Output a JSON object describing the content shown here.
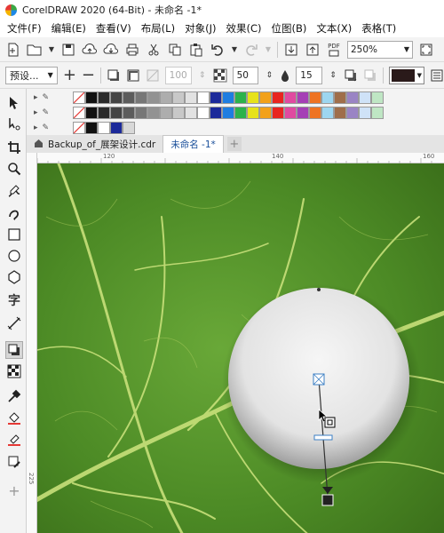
{
  "window": {
    "title": "CorelDRAW 2020 (64-Bit) - 未命名 -1*"
  },
  "menu": [
    "文件(F)",
    "编辑(E)",
    "查看(V)",
    "布局(L)",
    "对象(J)",
    "效果(C)",
    "位图(B)",
    "文本(X)",
    "表格(T)"
  ],
  "toolbar": {
    "zoom": "250%",
    "pdf_label": "PDF"
  },
  "property_bar": {
    "preset": "预设...",
    "transparency": "100",
    "feather": "50",
    "direction": "15"
  },
  "palette": {
    "row1": [
      "#ffffff",
      "#111111",
      "#2b2b2b",
      "#444444",
      "#5c5c5c",
      "#777777",
      "#929292",
      "#adadad",
      "#c8c8c8",
      "#e2e2e2",
      "#ffffff",
      "#1c2a9a",
      "#1f7de0",
      "#2cb24b",
      "#e7e21a",
      "#f2a11a",
      "#e8251f",
      "#e04aa0",
      "#a53fb5",
      "#ee7322",
      "#9dd6f0",
      "#9f6e4a",
      "#9a84c4",
      "#cfe2f7",
      "#bfe6c4"
    ],
    "row2": [
      "#ffffff",
      "#111111",
      "#2b2b2b",
      "#444444",
      "#5c5c5c",
      "#777777",
      "#929292",
      "#adadad",
      "#c8c8c8",
      "#e2e2e2",
      "#ffffff",
      "#1c2a9a",
      "#1f7de0",
      "#2cb24b",
      "#e7e21a",
      "#f2a11a",
      "#e8251f",
      "#e04aa0",
      "#a53fb5",
      "#ee7322",
      "#9dd6f0",
      "#9f6e4a",
      "#9a84c4",
      "#cfe2f7",
      "#bfe6c4"
    ],
    "row3": [
      "#ffffff",
      "#111111",
      "#ffffff",
      "#1c2a9a",
      "#d8d8d8"
    ]
  },
  "tabs": [
    {
      "label": "Backup_of_展架设计.cdr",
      "active": false
    },
    {
      "label": "未命名 -1*",
      "active": true
    }
  ],
  "ruler": {
    "top": [
      "120",
      "140",
      "160"
    ],
    "left": [
      "225"
    ]
  },
  "colors": {
    "canvas_green": "#4f8f2a",
    "fill_swatch": "#2a1a1a"
  }
}
